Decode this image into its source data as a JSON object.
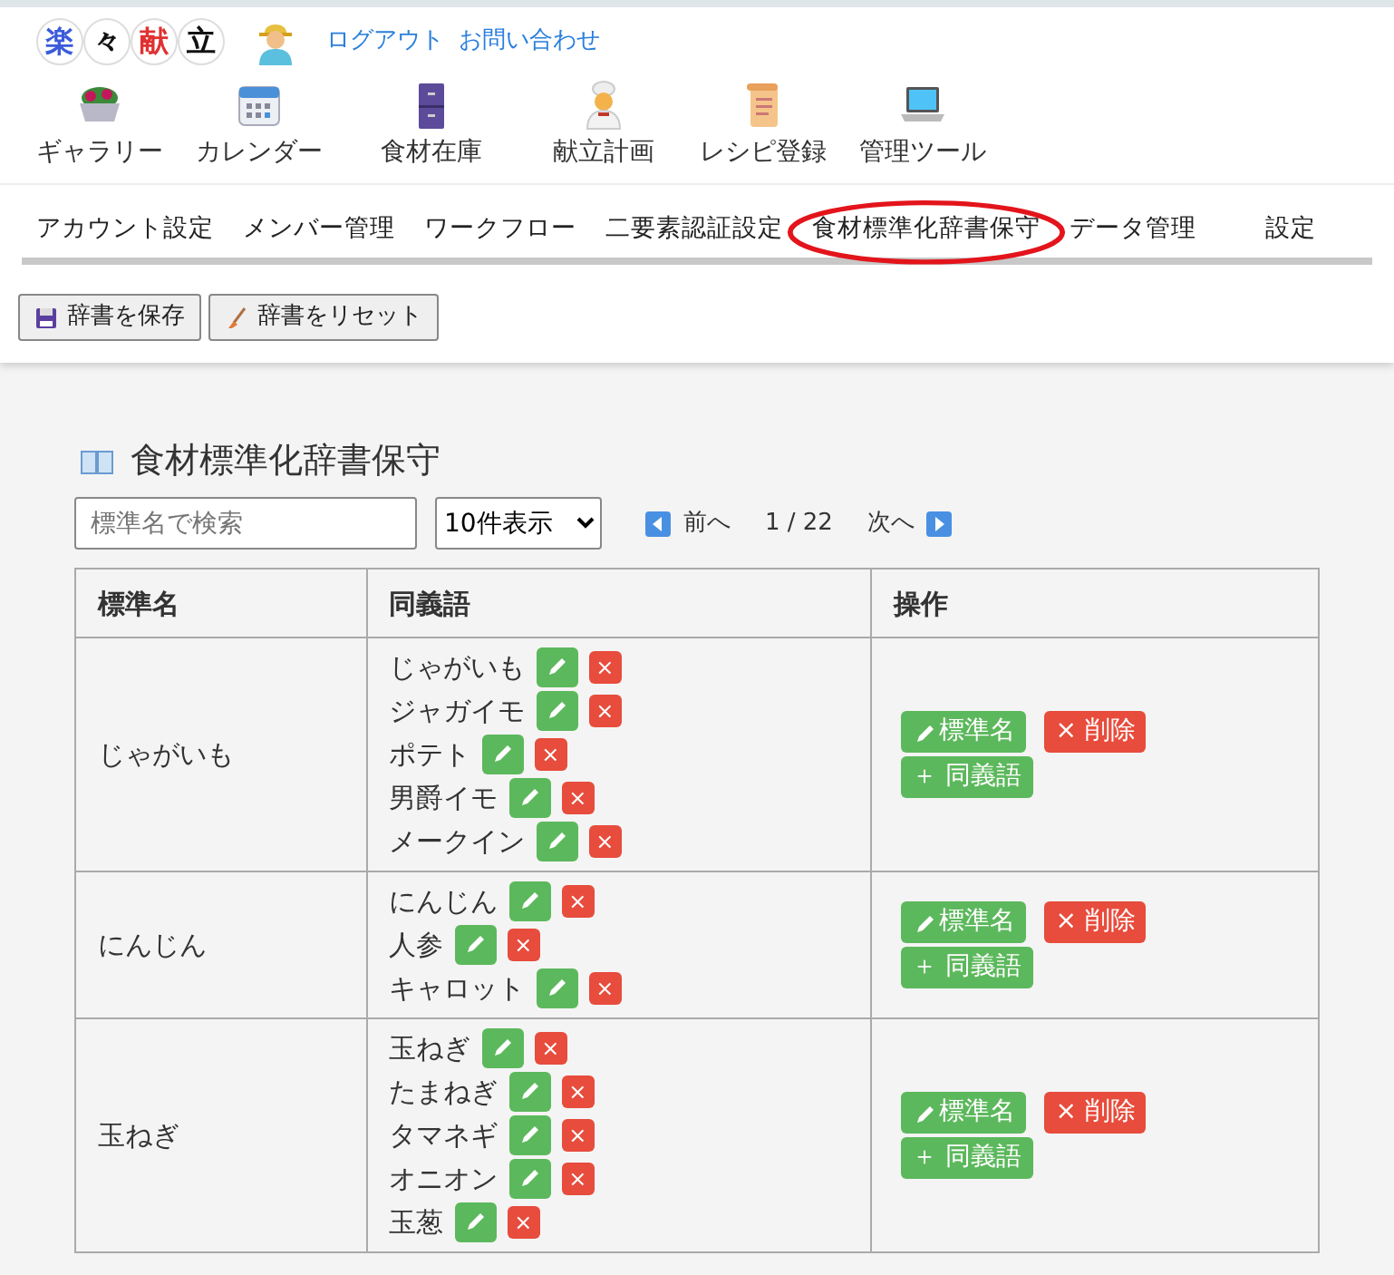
{
  "logo": [
    {
      "char": "楽",
      "color": "#3b5bdb"
    },
    {
      "char": "々",
      "color": "#111111"
    },
    {
      "char": "献",
      "color": "#e03131"
    },
    {
      "char": "立",
      "color": "#111111"
    }
  ],
  "header_links": [
    "ログアウト",
    "お問い合わせ"
  ],
  "main_nav": [
    {
      "label": "ギャラリー",
      "kind": "salad"
    },
    {
      "label": "カレンダー",
      "kind": "calendar"
    },
    {
      "label": "食材在庫",
      "kind": "cabinet"
    },
    {
      "label": "献立計画",
      "kind": "chef"
    },
    {
      "label": "レシピ登録",
      "kind": "scroll"
    },
    {
      "label": "管理ツール",
      "kind": "laptop"
    }
  ],
  "tabs": [
    {
      "label": "アカウント設定",
      "circled": false
    },
    {
      "label": "メンバー管理",
      "circled": false
    },
    {
      "label": "ワークフロー",
      "circled": false
    },
    {
      "label": "二要素認証設定",
      "circled": false
    },
    {
      "label": "食材標準化辞書保守",
      "circled": true
    },
    {
      "label": "データ管理",
      "circled": false
    },
    {
      "label": "設定",
      "circled": false
    }
  ],
  "toolbar": [
    {
      "label": "辞書を保存",
      "kind": "save"
    },
    {
      "label": "辞書をリセット",
      "kind": "reset"
    }
  ],
  "title": "食材標準化辞書保守",
  "search": {
    "placeholder": "標準名で検索"
  },
  "page_size": "10件表示",
  "pager": {
    "prev": "前へ",
    "page": "1 / 22",
    "next": "次へ"
  },
  "table": {
    "columns": [
      "標準名",
      "同義語",
      "操作"
    ],
    "rows": [
      {
        "name": "じゃがいも",
        "synonyms": [
          {
            "text": "じゃがいも",
            "delete": "×"
          },
          {
            "text": "ジャガイモ",
            "delete": "×"
          },
          {
            "text": "ポテト",
            "delete": "×"
          },
          {
            "text": "男爵イモ",
            "delete": "×"
          },
          {
            "text": "メークイン",
            "delete": "×"
          }
        ],
        "actions": [
          {
            "kind": "rename",
            "label": "標準名"
          },
          {
            "kind": "delete",
            "icon": "×",
            "label": "削除"
          },
          {
            "kind": "add",
            "icon": "＋",
            "label": "同義語"
          }
        ]
      },
      {
        "name": "にんじん",
        "synonyms": [
          {
            "text": "にんじん",
            "delete": "×"
          },
          {
            "text": "人参",
            "delete": "×"
          },
          {
            "text": "キャロット",
            "delete": "×"
          }
        ],
        "actions": [
          {
            "kind": "rename",
            "label": "標準名"
          },
          {
            "kind": "delete",
            "icon": "×",
            "label": "削除"
          },
          {
            "kind": "add",
            "icon": "＋",
            "label": "同義語"
          }
        ]
      },
      {
        "name": "玉ねぎ",
        "synonyms": [
          {
            "text": "玉ねぎ",
            "delete": "×"
          },
          {
            "text": "たまねぎ",
            "delete": "×"
          },
          {
            "text": "タマネギ",
            "delete": "×"
          },
          {
            "text": "オニオン",
            "delete": "×"
          },
          {
            "text": "玉葱",
            "delete": "×"
          }
        ],
        "actions": [
          {
            "kind": "rename",
            "label": "標準名"
          },
          {
            "kind": "delete",
            "icon": "×",
            "label": "削除"
          },
          {
            "kind": "add",
            "icon": "＋",
            "label": "同義語"
          }
        ]
      }
    ]
  }
}
